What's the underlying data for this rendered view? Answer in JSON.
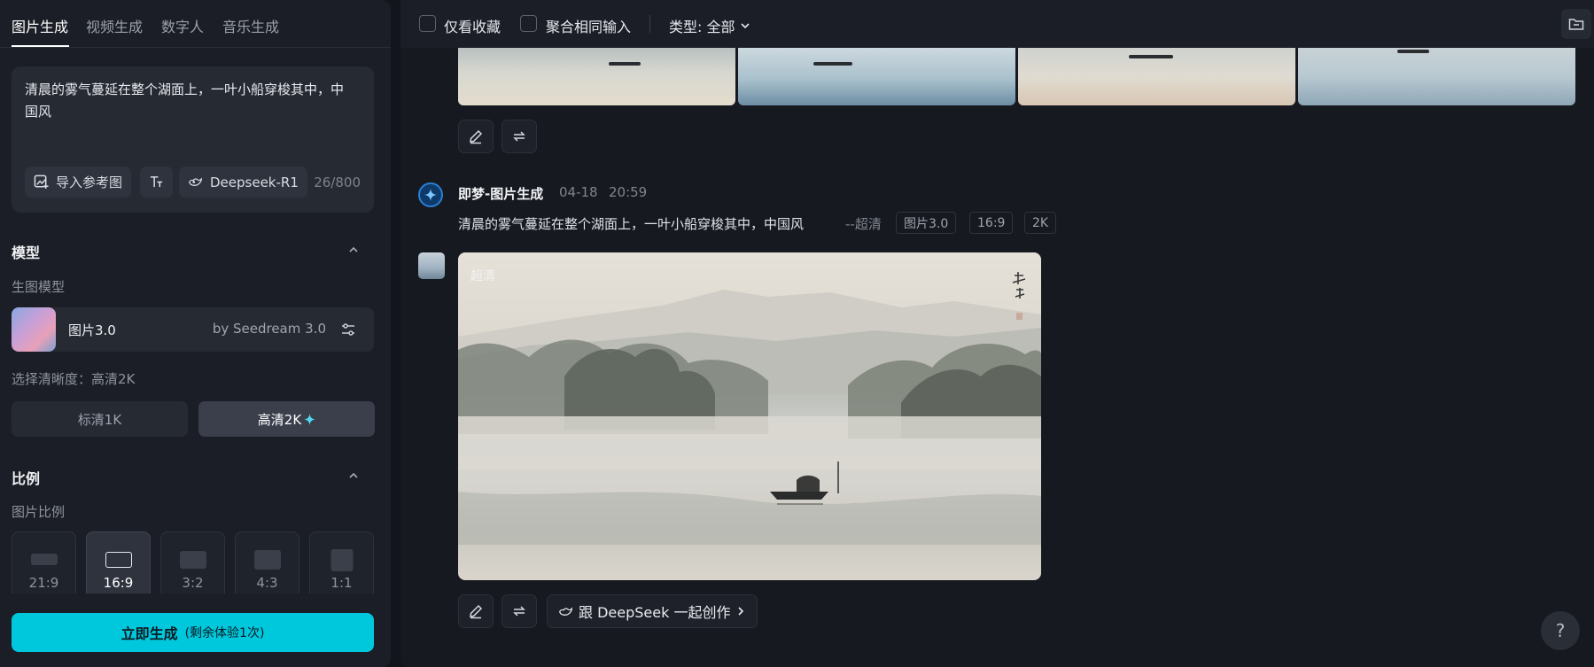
{
  "tabs": [
    {
      "label": "图片生成",
      "active": true
    },
    {
      "label": "视频生成",
      "active": false
    },
    {
      "label": "数字人",
      "active": false
    },
    {
      "label": "音乐生成",
      "active": false
    }
  ],
  "prompt": {
    "text": "清晨的雾气蔓延在整个湖面上，一叶小船穿梭其中，中国风",
    "import_ref_label": "导入参考图",
    "deepseek_label": "Deepseek-R1",
    "char_count": "26/800"
  },
  "model_section": {
    "title": "模型",
    "sub_label": "生图模型",
    "model_name": "图片3.0",
    "model_by": "by Seedream 3.0",
    "resolution_label": "选择清晰度：高清2K",
    "res_1k": "标清1K",
    "res_2k": "高清2K"
  },
  "ratio_section": {
    "title": "比例",
    "sub_label": "图片比例",
    "options": [
      {
        "label": "21:9",
        "selected": false
      },
      {
        "label": "16:9",
        "selected": true
      },
      {
        "label": "3:2",
        "selected": false
      },
      {
        "label": "4:3",
        "selected": false
      },
      {
        "label": "1:1",
        "selected": false
      }
    ]
  },
  "generate": {
    "label": "立即生成",
    "sub": "(剩余体验1次)"
  },
  "topbar": {
    "favorites_label": "仅看收藏",
    "merge_label": "聚合相同输入",
    "type_label": "类型: 全部"
  },
  "message": {
    "title": "即梦-图片生成",
    "date": "04-18",
    "time": "20:59",
    "prompt": "清晨的雾气蔓延在整个湖面上，一叶小船穿梭其中，中国风",
    "flag": "--超清",
    "tags": [
      "图片3.0",
      "16:9",
      "2K"
    ],
    "image_badge": "超清",
    "deepseek_button": "跟 DeepSeek 一起创作"
  },
  "help_label": "?",
  "colors": {
    "accent": "#00c8dc",
    "bg": "#13151c",
    "panel": "#1b1e26"
  }
}
